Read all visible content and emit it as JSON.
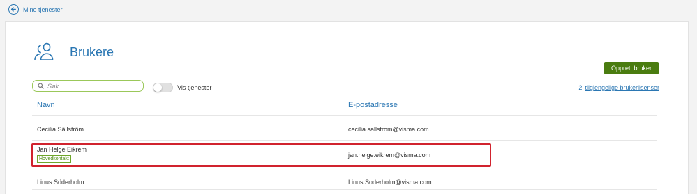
{
  "back": {
    "label": "Mine tjenester"
  },
  "page": {
    "title": "Brukere"
  },
  "actions": {
    "create_user_label": "Opprett bruker"
  },
  "search": {
    "placeholder": "Søk"
  },
  "toggle": {
    "label": "Vis tjenester",
    "on": false
  },
  "licenses": {
    "count": "2",
    "label": "tilgjengelige brukerlisenser"
  },
  "table": {
    "headers": {
      "name": "Navn",
      "email": "E-postadresse"
    },
    "rows": [
      {
        "name": "Cecilia Sällström",
        "email": "cecilia.sallstrom@visma.com",
        "badge": ""
      },
      {
        "name": "Jan Helge Eikrem",
        "email": "jan.helge.eikrem@visma.com",
        "badge": "Hovedkontakt"
      },
      {
        "name": "Linus Söderholm",
        "email": "Linus.Soderholm@visma.com",
        "badge": ""
      }
    ]
  },
  "colors": {
    "accent": "#2b77b3",
    "primary_button": "#4a7c10",
    "search_border": "#9bc85a",
    "highlight": "#d1232e"
  }
}
